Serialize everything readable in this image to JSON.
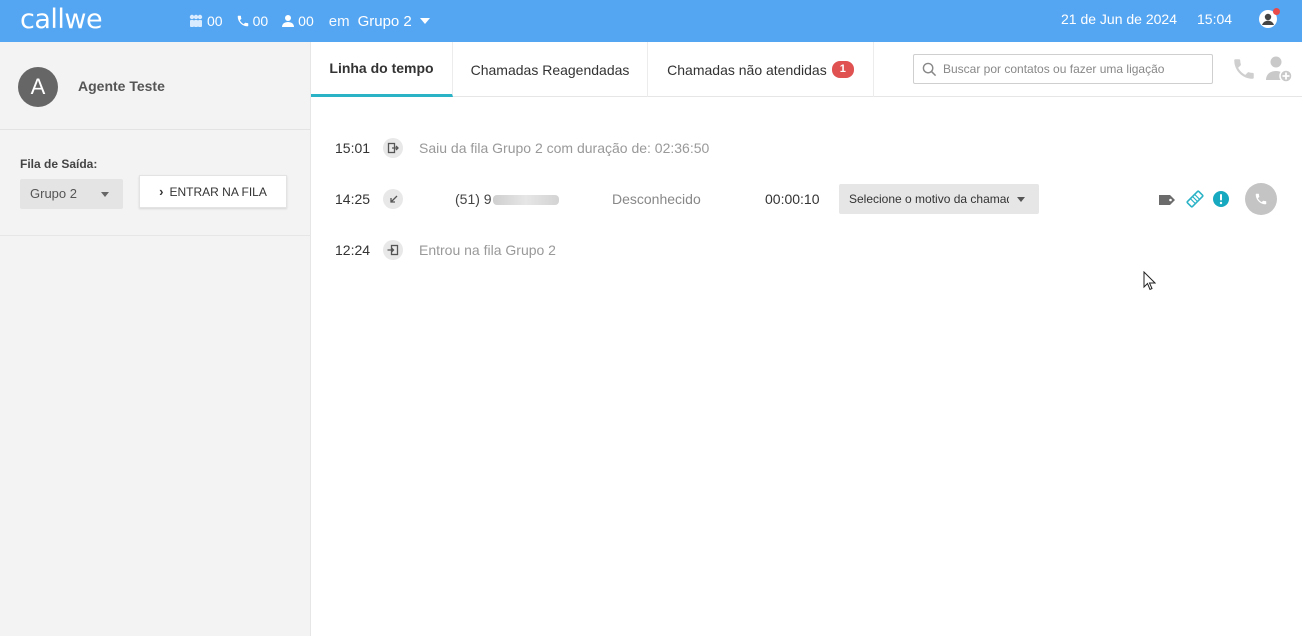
{
  "brand": {
    "logo": "callwe"
  },
  "header": {
    "stats": [
      {
        "icon": "group-icon",
        "value": "00"
      },
      {
        "icon": "phone-icon",
        "value": "00"
      },
      {
        "icon": "user-icon",
        "value": "00"
      }
    ],
    "in_label": "em",
    "group": "Grupo 2",
    "date": "21 de Jun de 2024",
    "time": "15:04"
  },
  "sidebar": {
    "agent_initial": "A",
    "agent_name": "Agente Teste",
    "queue_label": "Fila de Saída:",
    "queue_value": "Grupo 2",
    "enter_button": "ENTRAR NA FILA"
  },
  "tabs": [
    {
      "label": "Linha do tempo",
      "active": true
    },
    {
      "label": "Chamadas Reagendadas",
      "active": false
    },
    {
      "label": "Chamadas não atendidas",
      "badge": "1",
      "active": false
    }
  ],
  "search": {
    "placeholder": "Buscar por contatos ou fazer uma ligação"
  },
  "timeline": [
    {
      "time": "15:01",
      "icon": "exit-queue-icon",
      "text": "Saiu da fila Grupo 2 com duração de: 02:36:50"
    },
    {
      "time": "14:25",
      "icon": "incoming-call-icon",
      "phone": "(51) 9",
      "contact": "Desconhecido",
      "duration": "00:00:10",
      "reason": "Selecione o motivo da chamada"
    },
    {
      "time": "12:24",
      "icon": "enter-queue-icon",
      "text": "Entrou na fila Grupo 2"
    }
  ],
  "colors": {
    "topbar": "#55a6f2",
    "accent": "#2ab2c6",
    "badge": "#e05252"
  }
}
